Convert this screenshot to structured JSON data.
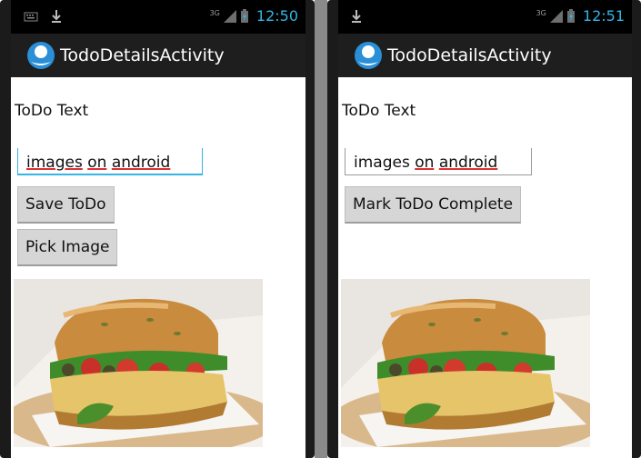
{
  "status": {
    "left": {
      "time": "12:50"
    },
    "right": {
      "time": "12:51"
    },
    "network": "3G"
  },
  "app": {
    "title": "TodoDetailsActivity"
  },
  "screens": [
    {
      "label": "ToDo Text",
      "field": {
        "words": [
          "images",
          "on",
          "android"
        ]
      },
      "buttons": [
        "Save ToDo",
        "Pick Image"
      ]
    },
    {
      "label": "ToDo Text",
      "field": {
        "words": [
          "images",
          "on",
          "android"
        ]
      },
      "buttons": [
        "Mark ToDo Complete"
      ]
    }
  ],
  "colors": {
    "accent": "#33b5e5",
    "actionbar": "#1e1e1e",
    "statusbar": "#000000",
    "button": "#d6d6d6"
  },
  "icons": [
    "keyboard-icon",
    "download-icon",
    "signal-icon",
    "battery-charging-icon",
    "app-logo-icon"
  ]
}
